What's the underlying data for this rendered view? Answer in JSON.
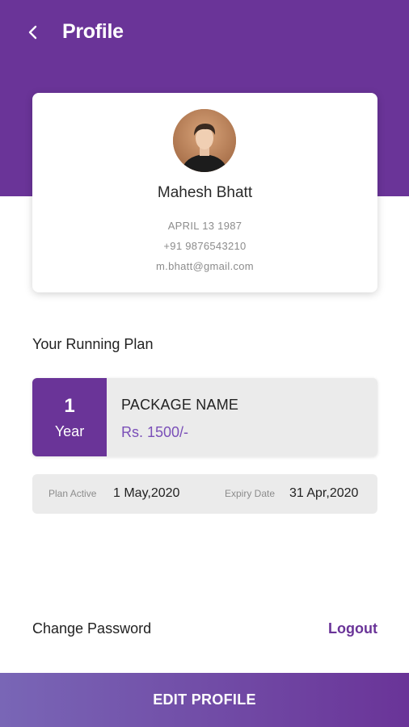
{
  "colors": {
    "primary": "#6a3498",
    "price": "#7a4fb8",
    "surface": "#ebebeb",
    "button_gradient_start": "#7966b6",
    "button_gradient_end": "#6a3498"
  },
  "header": {
    "back_icon": "chevron-left-icon",
    "title": "Profile"
  },
  "profile": {
    "avatar": "user-photo",
    "name": "Mahesh Bhatt",
    "dob": "APRIL 13 1987",
    "phone": "+91 9876543210",
    "email": "m.bhatt@gmail.com"
  },
  "plan": {
    "section_label": "Your Running Plan",
    "duration_number": "1",
    "duration_unit": "Year",
    "package_name": "PACKAGE NAME",
    "price": "Rs. 1500/-",
    "active_label": "Plan Active",
    "active_date": "1 May,2020",
    "expiry_label": "Expiry Date",
    "expiry_date": "31 Apr,2020"
  },
  "actions": {
    "change_password": "Change Password",
    "logout": "Logout",
    "edit_profile": "EDIT PROFILE"
  }
}
